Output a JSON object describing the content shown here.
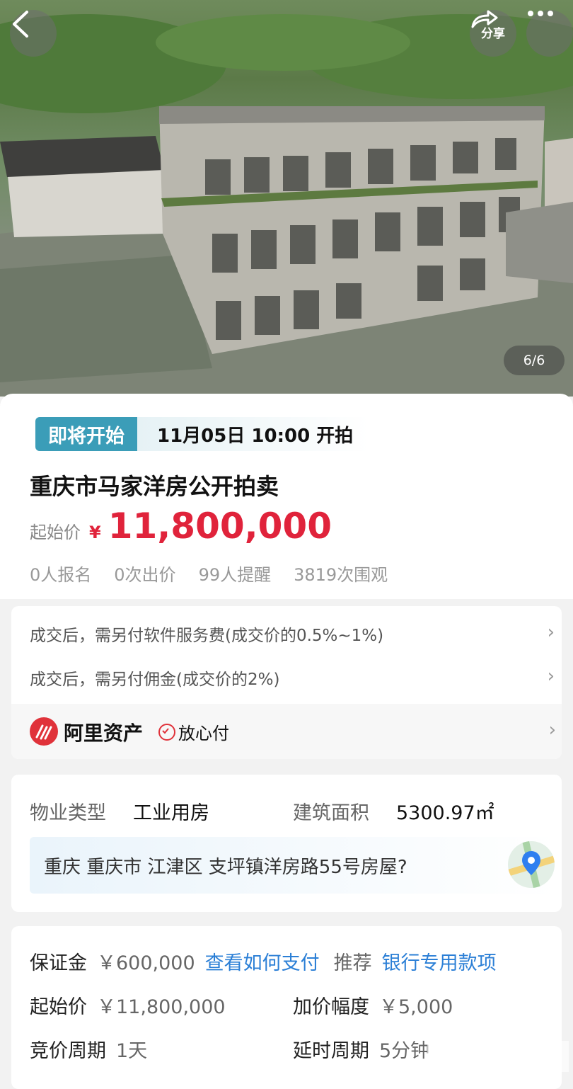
{
  "hero": {
    "share_label": "分享",
    "image_counter": "6/6"
  },
  "auction": {
    "status_badge": "即将开始",
    "start_time": "11月05日 10:00 开拍",
    "title": "重庆市马家洋房公开拍卖",
    "price_label": "起始价",
    "currency_symbol": "¥",
    "start_price": "11,800,000",
    "stats": {
      "signups": "0人报名",
      "bids": "0次出价",
      "reminders": "99人提醒",
      "views": "3819次围观"
    }
  },
  "fees": {
    "service_fee": "成交后，需另付软件服务费(成交价的0.5%~1%)",
    "commission": "成交后，需另付佣金(成交价的2%)",
    "provider_name": "阿里资产",
    "guarantee_label": "放心付"
  },
  "property": {
    "type_label": "物业类型",
    "type_value": "工业用房",
    "area_label": "建筑面积",
    "area_value": "5300.97㎡",
    "address": "重庆 重庆市 江津区 支坪镇洋房路55号房屋?"
  },
  "bidding": {
    "deposit_label": "保证金",
    "deposit_value": "￥600,000",
    "how_to_pay_link": "查看如何支付",
    "recommend_label": "推荐",
    "recommend_link": "银行专用款项",
    "start_price_label": "起始价",
    "start_price_value": "￥11,800,000",
    "increment_label": "加价幅度",
    "increment_value": "￥5,000",
    "cycle_label": "竞价周期",
    "cycle_value": "1天",
    "extension_label": "延时周期",
    "extension_value": "5分钟"
  },
  "colors": {
    "accent_red": "#e0233b",
    "badge_teal": "#3b9db8",
    "link_blue": "#2b7fd6"
  }
}
